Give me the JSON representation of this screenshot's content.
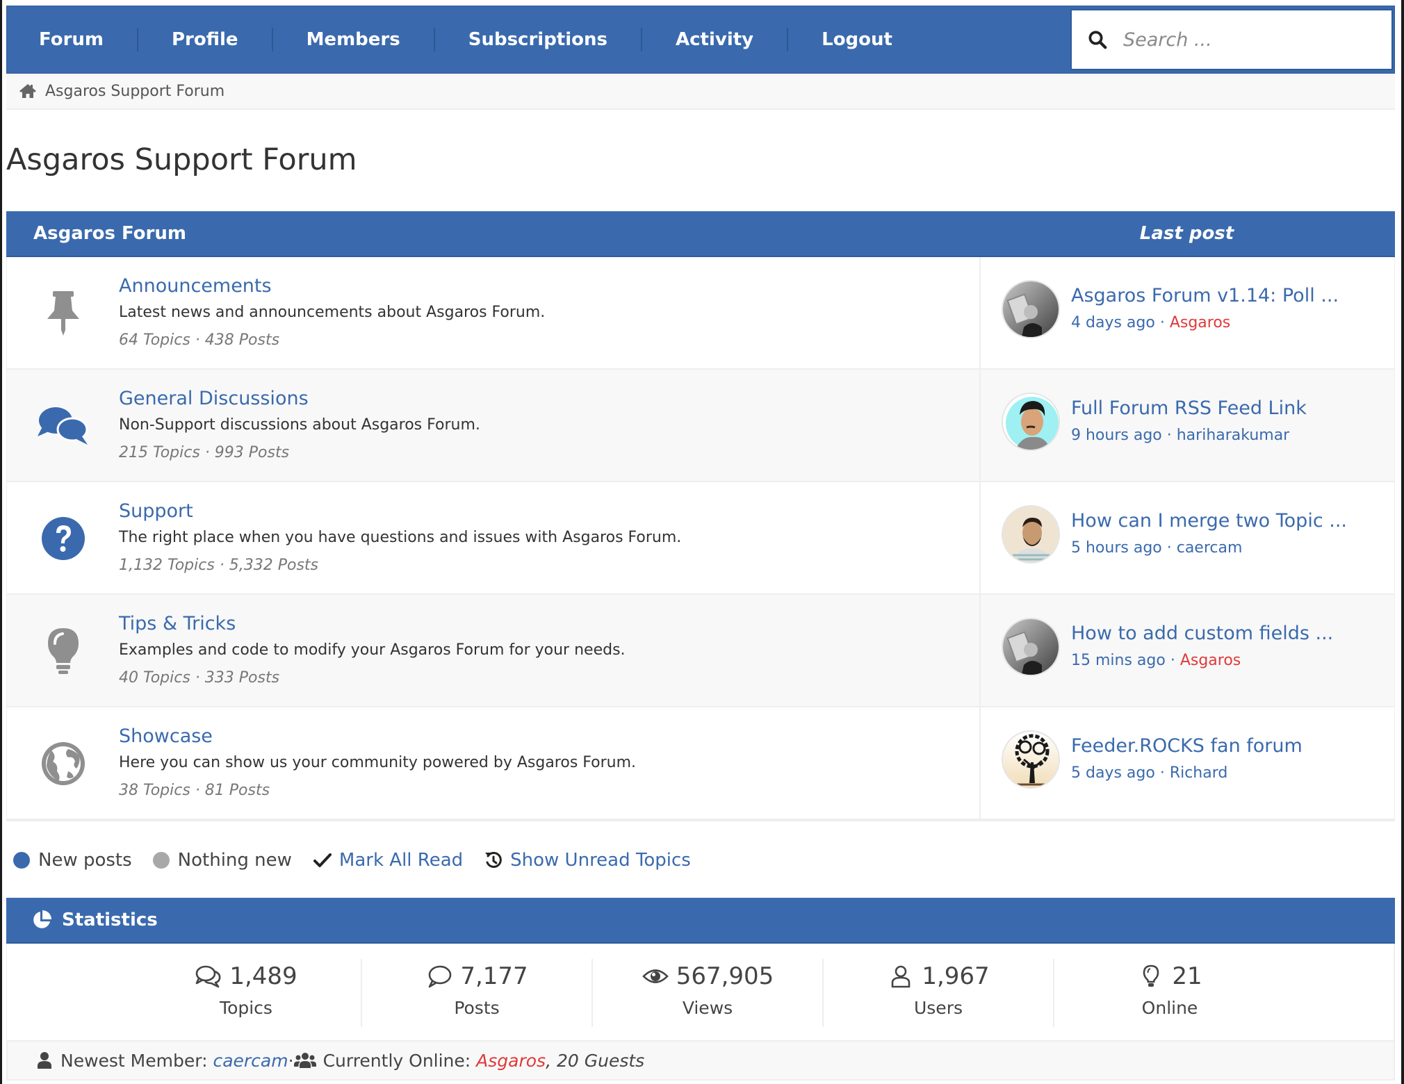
{
  "nav": {
    "items": [
      {
        "label": "Forum"
      },
      {
        "label": "Profile"
      },
      {
        "label": "Members"
      },
      {
        "label": "Subscriptions"
      },
      {
        "label": "Activity"
      },
      {
        "label": "Logout"
      }
    ],
    "search_placeholder": "Search ..."
  },
  "breadcrumb": {
    "icon": "home-icon",
    "label": "Asgaros Support Forum"
  },
  "page_title": "Asgaros Support Forum",
  "forum_table": {
    "title": "Asgaros Forum",
    "last_post_header": "Last post",
    "rows": [
      {
        "icon": "thumbtack-icon",
        "name": "Announcements",
        "description": "Latest news and announcements about Asgaros Forum.",
        "counts": "64 Topics · 438 Posts",
        "last_post": {
          "title": "Asgaros Forum v1.14: Poll ...",
          "time": "4 days ago",
          "separator": " · ",
          "author": "Asgaros",
          "author_is_admin": true,
          "avatar": "grayscale-portrait-avatar"
        }
      },
      {
        "icon": "comments-icon",
        "name": "General Discussions",
        "description": "Non-Support discussions about Asgaros Forum.",
        "counts": "215 Topics · 993 Posts",
        "last_post": {
          "title": "Full Forum RSS Feed Link",
          "time": "9 hours ago",
          "separator": " · ",
          "author": "hariharakumar",
          "author_is_admin": false,
          "avatar": "cartoon-man-avatar"
        }
      },
      {
        "icon": "question-circle-icon",
        "name": "Support",
        "description": "The right place when you have questions and issues with Asgaros Forum.",
        "counts": "1,132 Topics · 5,332 Posts",
        "last_post": {
          "title": "How can I merge two Topic ...",
          "time": "5 hours ago",
          "separator": " · ",
          "author": "caercam",
          "author_is_admin": false,
          "avatar": "bearded-man-avatar"
        }
      },
      {
        "icon": "lightbulb-icon",
        "name": "Tips & Tricks",
        "description": "Examples and code to modify your Asgaros Forum for your needs.",
        "counts": "40 Topics · 333 Posts",
        "last_post": {
          "title": "How to add custom fields ...",
          "time": "15 mins ago",
          "separator": " · ",
          "author": "Asgaros",
          "author_is_admin": true,
          "avatar": "grayscale-portrait-avatar"
        }
      },
      {
        "icon": "globe-icon",
        "name": "Showcase",
        "description": "Here you can show us your community powered by Asgaros Forum.",
        "counts": "38 Topics · 81 Posts",
        "last_post": {
          "title": "Feeder.ROCKS fan forum",
          "time": "5 days ago",
          "separator": " · ",
          "author": "Richard",
          "author_is_admin": false,
          "avatar": "tree-avatar"
        }
      }
    ]
  },
  "legend": {
    "new_posts": "New posts",
    "nothing_new": "Nothing new",
    "mark_all_read": "Mark All Read",
    "show_unread": "Show Unread Topics"
  },
  "statistics": {
    "title": "Statistics",
    "items": [
      {
        "icon": "comments-outline-icon",
        "value": "1,489",
        "label": "Topics"
      },
      {
        "icon": "comment-outline-icon",
        "value": "7,177",
        "label": "Posts"
      },
      {
        "icon": "eye-icon",
        "value": "567,905",
        "label": "Views"
      },
      {
        "icon": "user-outline-icon",
        "value": "1,967",
        "label": "Users"
      },
      {
        "icon": "lightbulb-outline-icon",
        "value": "21",
        "label": "Online"
      }
    ],
    "footer": {
      "newest_label": "Newest Member:",
      "newest_member": "caercam",
      "separator": " · ",
      "online_label": "Currently Online:",
      "online_admin": "Asgaros",
      "online_rest": ", 20 Guests"
    }
  },
  "colors": {
    "accent": "#3a6aad",
    "admin": "#e03a3a",
    "muted": "#777777",
    "row_alt": "#f8f8f8"
  }
}
